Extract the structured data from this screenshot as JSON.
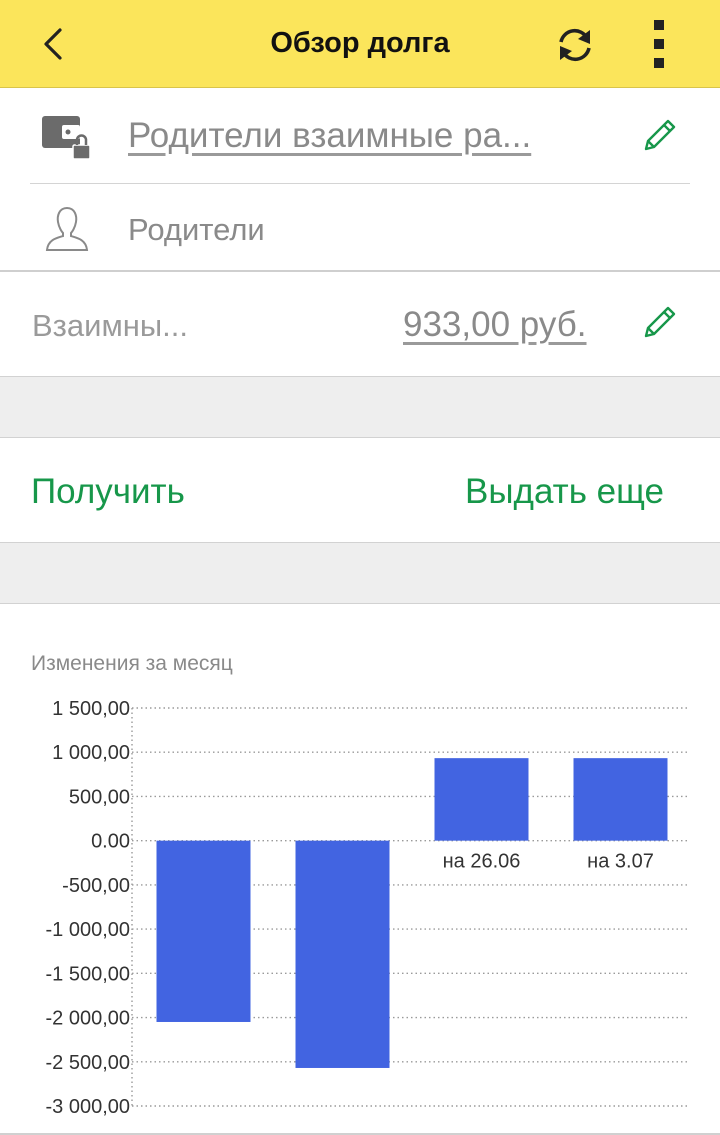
{
  "header": {
    "title": "Обзор долга",
    "back_icon": "back-arrow-icon",
    "refresh_icon": "refresh-icon",
    "menu_icon": "more-vertical-icon",
    "accent": "#fbe55b"
  },
  "wallet": {
    "text": "Родители взаимные ра...",
    "icon": "wallet-lock-icon"
  },
  "person": {
    "text": "Родители",
    "icon": "user-icon"
  },
  "amount": {
    "label": "Взаимны...",
    "value": "933,00 руб."
  },
  "actions": {
    "receive_label": "Получить",
    "give_label": "Выдать еще",
    "color": "#17974a"
  },
  "chart_data": {
    "type": "bar",
    "title": "Изменения за месяц",
    "categories": [
      "",
      "",
      "на 26.06",
      "на 3.07"
    ],
    "values": [
      -2050,
      -2570,
      933,
      933
    ],
    "ylim": [
      -3000,
      1500
    ],
    "yticks": [
      1500,
      1000,
      500,
      0,
      -500,
      -1000,
      -1500,
      -2000,
      -2500,
      -3000
    ],
    "ytick_labels": [
      "1 500,00",
      "1 000,00",
      "500,00",
      "0.00",
      "-500,00",
      "-1 000,00",
      "-1 500,00",
      "-2 000,00",
      "-2 500,00",
      "-3 000,00"
    ],
    "grid": true,
    "bar_color": "#4264e1"
  }
}
